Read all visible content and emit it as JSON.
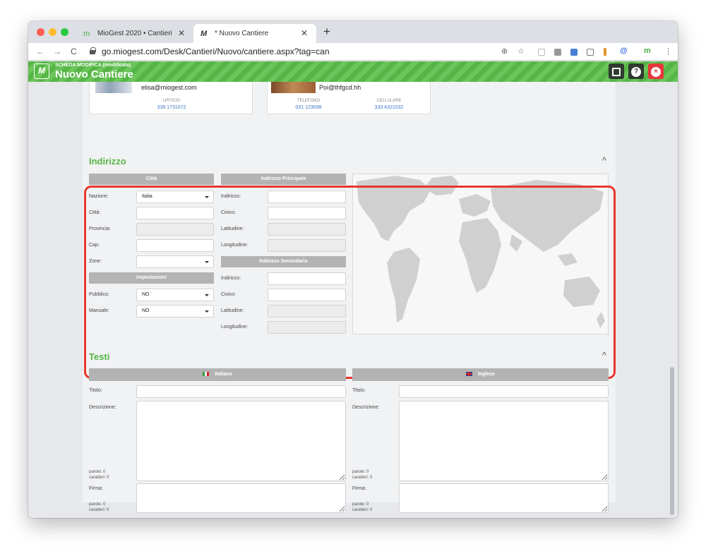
{
  "browser": {
    "tabs": [
      {
        "title": "MioGest 2020 • Cantieri",
        "icon": "miogest-icon"
      },
      {
        "title": "* Nuovo Cantiere",
        "icon": "nuovo-cantiere-icon"
      }
    ],
    "url": "go.miogest.com/Desk/Cantieri/Nuovo/cantiere.aspx?tag=can",
    "nav_back": "←",
    "nav_forward": "→",
    "nav_reload": "C",
    "new_tab": "+",
    "tab_close": "✕",
    "toolbar_icons": {
      "zoom": "⊕",
      "star": "☆",
      "account": "@",
      "miogest": "m",
      "menu": "⋮"
    }
  },
  "header": {
    "subtitle": "SCHEDA MODIFICA (modificata)",
    "title": "Nuovo Cantiere",
    "logo_text": "M",
    "help": "?",
    "close": "×",
    "accent": "#56b646",
    "close_color": "#e5383b"
  },
  "contacts": [
    {
      "email": "elisa@miogest.com",
      "labels": [
        "UFFICIO"
      ],
      "values": [
        "339 1731072"
      ]
    },
    {
      "email": "Poi@thfgcd.hh",
      "labels": [
        "TELEFONO",
        "CELLULARE"
      ],
      "values": [
        "031 123098",
        "333 4321532"
      ]
    }
  ],
  "indirizzo": {
    "title": "Indirizzo",
    "chevron": "^",
    "citta": {
      "header": "Città",
      "fields": [
        {
          "label": "Nazione:",
          "value": "Italia",
          "type": "select"
        },
        {
          "label": "Città:",
          "value": "",
          "type": "input"
        },
        {
          "label": "Provincia:",
          "value": "",
          "type": "disabled"
        },
        {
          "label": "Cap:",
          "value": "",
          "type": "input"
        },
        {
          "label": "Zone:",
          "value": "",
          "type": "select"
        }
      ]
    },
    "impostazioni": {
      "header": "Impostazioni",
      "fields": [
        {
          "label": "Pubblico:",
          "value": "NO",
          "type": "select"
        },
        {
          "label": "Manuale:",
          "value": "NO",
          "type": "select"
        }
      ]
    },
    "principale": {
      "header": "Indirizzo Principale",
      "fields": [
        {
          "label": "Indirizzo:",
          "value": "",
          "type": "input"
        },
        {
          "label": "Civico:",
          "value": "",
          "type": "input"
        },
        {
          "label": "Latitudine:",
          "value": "",
          "type": "disabled"
        },
        {
          "label": "Longitudine:",
          "value": "",
          "type": "disabled"
        }
      ]
    },
    "secondario": {
      "header": "Indirizzo Secondario",
      "fields": [
        {
          "label": "Indirizzo:",
          "value": "",
          "type": "input"
        },
        {
          "label": "Civico:",
          "value": "",
          "type": "input"
        },
        {
          "label": "Latitudine:",
          "value": "",
          "type": "disabled"
        },
        {
          "label": "Longitudine:",
          "value": "",
          "type": "disabled"
        }
      ]
    },
    "highlight_color": "#e8362c"
  },
  "testi": {
    "title": "Testi",
    "chevron": "^",
    "languages": [
      {
        "name": "Italiano",
        "flag": "flag-italy-icon",
        "titolo_label": "Titolo:",
        "descrizione_label": "Descrizione:",
        "descrizione_parole": "parole: 0",
        "descrizione_caratteri": "caratteri: 0",
        "firma_label": "Firma:",
        "firma_parole": "parole: 0",
        "firma_caratteri": "caratteri: 0"
      },
      {
        "name": "Inglese",
        "flag": "flag-uk-icon",
        "titolo_label": "Titolo:",
        "descrizione_label": "Descrizione:",
        "descrizione_parole": "parole: 0",
        "descrizione_caratteri": "caratteri: 0",
        "firma_label": "Firma:",
        "firma_parole": "parole: 0",
        "firma_caratteri": "caratteri: 0"
      }
    ]
  }
}
